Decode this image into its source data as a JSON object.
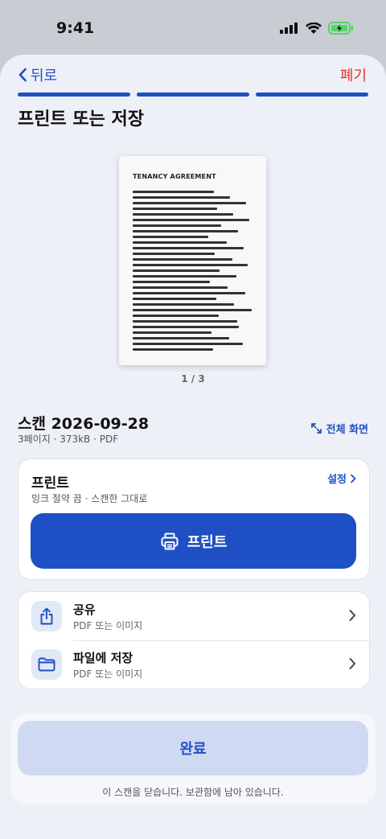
{
  "status_bar": {
    "time": "9:41"
  },
  "nav": {
    "back_label": "뒤로",
    "discard_label": "폐기"
  },
  "progress": {
    "total_steps": 3,
    "completed_steps": 3
  },
  "page_title": "프린트 또는 저장",
  "preview": {
    "doc_title": "TENANCY AGREEMENT",
    "page_indicator": "1 / 3"
  },
  "scan": {
    "name": "스캔 2026-09-28",
    "meta": "3페이지 · 373kB · PDF",
    "fullscreen_label": "전체 화면"
  },
  "print_card": {
    "title": "프린트",
    "subtitle": "잉크 절약 끔 · 스캔한 그대로",
    "settings_label": "설정",
    "button_label": "프린트"
  },
  "actions": [
    {
      "label": "공유",
      "sub": "PDF 또는 이미지",
      "icon": "share-icon"
    },
    {
      "label": "파일에 저장",
      "sub": "PDF 또는 이미지",
      "icon": "folder-icon"
    }
  ],
  "footer": {
    "done_label": "완료",
    "note": "이 스캔을 닫습니다. 보관함에 남아 있습니다."
  },
  "colors": {
    "accent": "#1e4fc4",
    "destructive": "#e0322f",
    "battery": "#4cd964"
  }
}
